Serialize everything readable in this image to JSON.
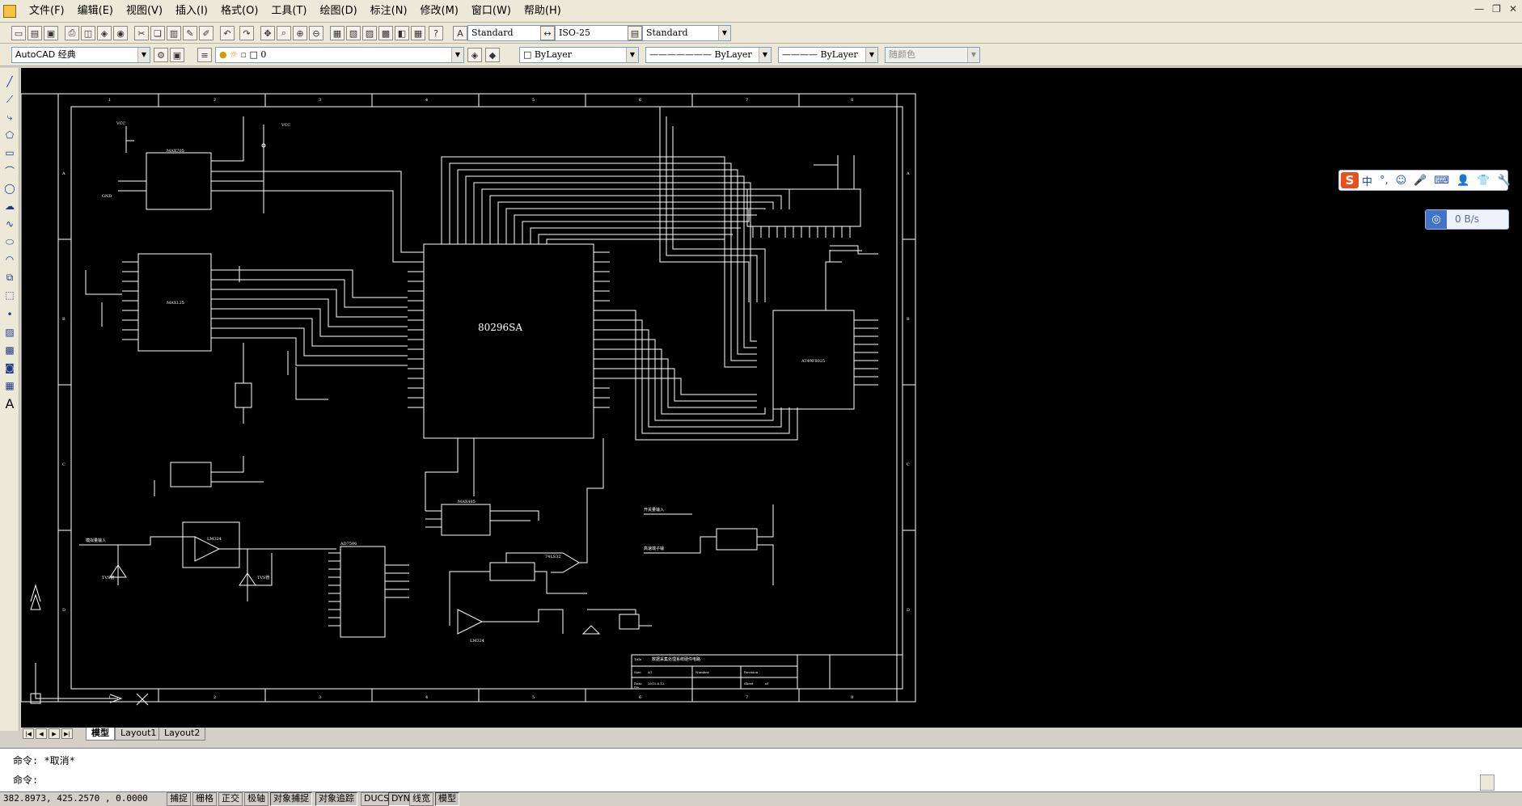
{
  "menu": {
    "items": [
      "文件(F)",
      "编辑(E)",
      "视图(V)",
      "插入(I)",
      "格式(O)",
      "工具(T)",
      "绘图(D)",
      "标注(N)",
      "修改(M)",
      "窗口(W)",
      "帮助(H)"
    ]
  },
  "toolbar": {
    "text_style": "Standard",
    "dim_style": "ISO-25",
    "table_style": "Standard",
    "workspace": "AutoCAD 经典",
    "layer": "0",
    "color": "ByLayer",
    "linetype": "ByLayer",
    "lineweight": "ByLayer",
    "plot_style": "随颜色"
  },
  "drawing": {
    "chip_main": "80296SA",
    "chip_max": "MAX705",
    "chip_ad": "AD7506",
    "chip_adc": "MAX125",
    "chip_rs": "MAX485",
    "chip_mem": "AT49F8025",
    "chip_amp1": "LM324",
    "chip_amp2": "LM324",
    "gate": "74LS32",
    "title_lbl": "Title",
    "title_text": "数据采集处理系统硬件电路",
    "size_lbl": "Size",
    "size_val": "A1",
    "number_lbl": "Number",
    "revision_lbl": "Revision",
    "date_lbl": "Date",
    "date_val": "2015.6.12",
    "sheet_lbl": "Sheet",
    "of_lbl": "of",
    "file_lbl": "File",
    "label_in1": "开关量输入",
    "label_in2": "高速端子输",
    "label_sig": "模拟量输入",
    "label_tvs1": "TVS管",
    "label_tvs2": "TVS管",
    "vcc": "VCC",
    "gnd": "GND",
    "col_marks": [
      "1",
      "2",
      "3",
      "4",
      "5",
      "6",
      "7",
      "8"
    ],
    "row_marks": [
      "A",
      "B",
      "C",
      "D"
    ]
  },
  "tabs": {
    "model": "模型",
    "layout1": "Layout1",
    "layout2": "Layout2"
  },
  "command": {
    "history": "命令: *取消*",
    "prompt": "命令:"
  },
  "status": {
    "coords": "382.8973, 425.2570 , 0.0000",
    "buttons": [
      "捕捉",
      "栅格",
      "正交",
      "极轴",
      "对象捕捉",
      "对象追踪",
      "DUCS",
      "DYN",
      "线宽",
      "模型"
    ]
  },
  "ime": {
    "logo": "S",
    "items": [
      "中",
      "°,",
      "☺",
      "🎤",
      "⌨",
      "👤",
      "👕",
      "🔧"
    ]
  },
  "net": {
    "rate": "0 B/s"
  },
  "colors": {
    "canvas": "#000000",
    "line": "#ffffff",
    "chrome": "#ece9d8",
    "ime_logo": "#e8501e",
    "net_icon": "#3f74c9"
  }
}
